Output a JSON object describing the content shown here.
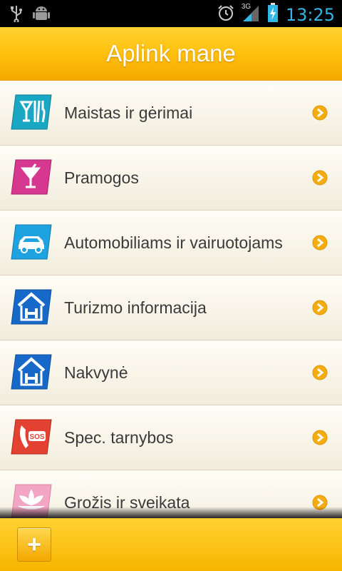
{
  "status_bar": {
    "time": "13:25",
    "network": "3G",
    "icons": [
      "usb-icon",
      "android-debug-icon",
      "alarm-icon",
      "signal-icon",
      "battery-charging-icon"
    ]
  },
  "header": {
    "title": "Aplink mane"
  },
  "list": {
    "items": [
      {
        "label": "Maistas ir gėrimai",
        "icon": "food-drink-icon",
        "icon_color": "#1aa7c3"
      },
      {
        "label": "Pramogos",
        "icon": "cocktail-icon",
        "icon_color": "#d6388f"
      },
      {
        "label": "Automobiliams ir vairuotojams",
        "icon": "car-icon",
        "icon_color": "#1fa2e0"
      },
      {
        "label": "Turizmo informacija",
        "icon": "hotel-house-icon",
        "icon_color": "#1669c9"
      },
      {
        "label": "Nakvynė",
        "icon": "hotel-house-icon",
        "icon_color": "#1669c9"
      },
      {
        "label": "Spec. tarnybos",
        "icon": "sos-phone-icon",
        "icon_color": "#e34232"
      },
      {
        "label": "Grožis ir sveikata",
        "icon": "lotus-icon",
        "icon_color": "#f3a6c4"
      }
    ]
  },
  "footer": {
    "add_button_label": "+"
  },
  "colors": {
    "accent": "#ffc310",
    "arrow": "#f4ad10"
  }
}
